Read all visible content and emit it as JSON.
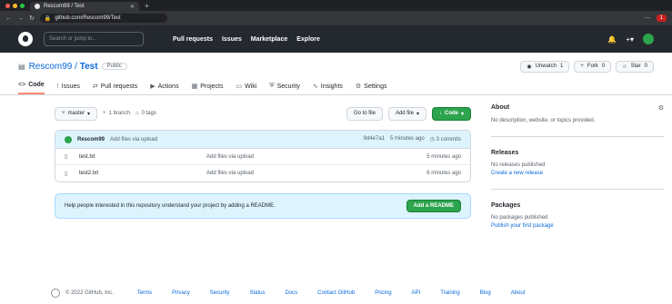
{
  "browser": {
    "tab_title": "Rescom99 / Test",
    "url": "github.com/Rescom99/Test",
    "badge": "1"
  },
  "header": {
    "search_placeholder": "Search or jump to...",
    "nav": [
      "Pull requests",
      "Issues",
      "Marketplace",
      "Explore"
    ]
  },
  "repo": {
    "owner": "Rescom99",
    "name": "Test",
    "visibility": "Public",
    "actions": [
      {
        "icon": "eye-icon",
        "label": "Unwatch",
        "count": "1"
      },
      {
        "icon": "fork-icon",
        "label": "Fork",
        "count": "0"
      },
      {
        "icon": "star-icon",
        "label": "Star",
        "count": "0"
      }
    ],
    "tabs": [
      {
        "icon": "<>",
        "label": "Code",
        "active": true
      },
      {
        "icon": "!",
        "label": "Issues"
      },
      {
        "icon": "⇄",
        "label": "Pull requests"
      },
      {
        "icon": "▶",
        "label": "Actions"
      },
      {
        "icon": "▦",
        "label": "Projects"
      },
      {
        "icon": "▭",
        "label": "Wiki"
      },
      {
        "icon": "⛨",
        "label": "Security"
      },
      {
        "icon": "∿",
        "label": "Insights"
      },
      {
        "icon": "⚙",
        "label": "Settings"
      }
    ]
  },
  "filenav": {
    "branch": "master",
    "branches": "1 branch",
    "tags": "0 tags",
    "goto": "Go to file",
    "add_file": "Add file",
    "code": "Code"
  },
  "commit": {
    "user": "Rescom99",
    "message": "Add files via upload",
    "hash": "9d4e7a1",
    "time": "5 minutes ago",
    "commits": "3 commits"
  },
  "files": [
    {
      "name": "test.txt",
      "message": "Add files via upload",
      "age": "5 minutes ago"
    },
    {
      "name": "test2.txt",
      "message": "Add files via upload",
      "age": "6 minutes ago"
    }
  ],
  "readme_prompt": {
    "text": "Help people interested in this repository understand your project by adding a README.",
    "button": "Add a README"
  },
  "sidebar": {
    "about_title": "About",
    "about_text": "No description, website, or topics provided.",
    "releases_title": "Releases",
    "releases_text": "No releases published",
    "releases_link": "Create a new release",
    "packages_title": "Packages",
    "packages_text": "No packages published",
    "packages_link": "Publish your first package"
  },
  "footer": {
    "copyright": "© 2022 GitHub, Inc.",
    "links": [
      "Terms",
      "Privacy",
      "Security",
      "Status",
      "Docs",
      "Contact GitHub",
      "Pricing",
      "API",
      "Training",
      "Blog",
      "About"
    ]
  }
}
